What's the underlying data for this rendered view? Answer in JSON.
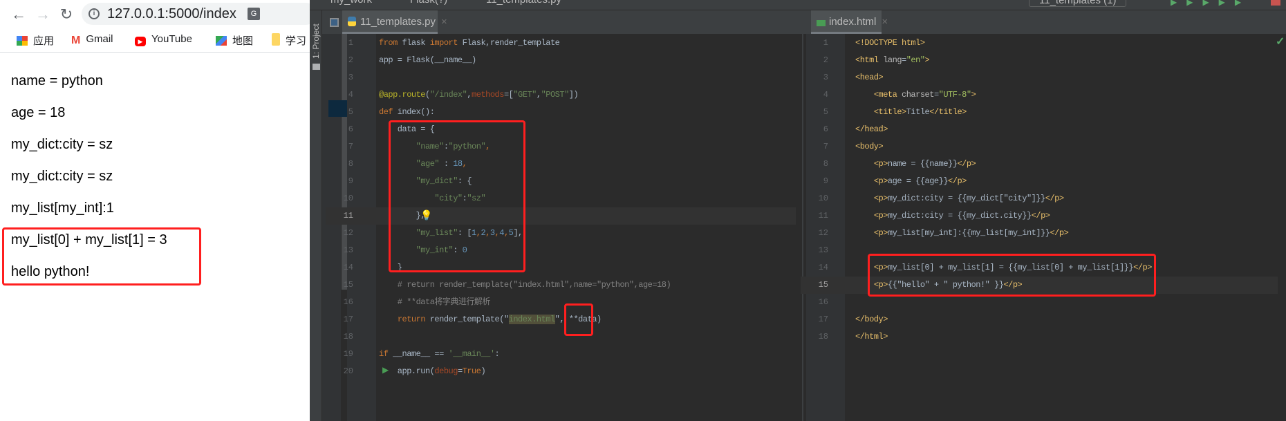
{
  "browser": {
    "url": "127.0.0.1:5000/index",
    "bookmarks": [
      {
        "label": "应用",
        "icon": "apps-grid-icon"
      },
      {
        "label": "Gmail",
        "icon": "gmail-icon"
      },
      {
        "label": "YouTube",
        "icon": "youtube-icon"
      },
      {
        "label": "地图",
        "icon": "maps-icon"
      },
      {
        "label": "学习",
        "icon": "folder-icon"
      }
    ],
    "page_lines": [
      "name = python",
      "age = 18",
      "my_dict:city = sz",
      "my_dict:city = sz",
      "my_list[my_int]:1",
      "my_list[0] + my_list[1] = 3",
      "hello python!"
    ]
  },
  "ide": {
    "breadcrumb": [
      "my_work",
      "Flask(?)",
      "11_templates.py"
    ],
    "run_config": "11_templates (1)",
    "project_label": "1: Project",
    "left_tab": "11_templates.py",
    "right_tab": "index.html",
    "left_code": [
      [
        [
          "from",
          "kw"
        ],
        [
          " flask ",
          ""
        ],
        [
          "import",
          "kw"
        ],
        [
          " Flask,render_template",
          ""
        ]
      ],
      [
        [
          "app = Flask(__name__)",
          ""
        ]
      ],
      [],
      [
        [
          "@app.route",
          "dec"
        ],
        [
          "(",
          ""
        ],
        [
          "\"/index\"",
          "str"
        ],
        [
          ",",
          ""
        ],
        [
          "methods",
          "kwarg"
        ],
        [
          "=[",
          ""
        ],
        [
          "\"GET\"",
          "str"
        ],
        [
          ",",
          ""
        ],
        [
          "\"POST\"",
          "str"
        ],
        [
          "])",
          ""
        ]
      ],
      [
        [
          "def",
          "kw"
        ],
        [
          " index():",
          ""
        ]
      ],
      [
        [
          "    data = {",
          ""
        ]
      ],
      [
        [
          "        ",
          ""
        ],
        [
          "\"name\"",
          "str"
        ],
        [
          ":",
          ""
        ],
        [
          "\"python\"",
          "str"
        ],
        [
          ",",
          "kw"
        ]
      ],
      [
        [
          "        ",
          ""
        ],
        [
          "\"age\"",
          "str"
        ],
        [
          " : ",
          ""
        ],
        [
          "18",
          "num"
        ],
        [
          ",",
          "kw"
        ]
      ],
      [
        [
          "        ",
          ""
        ],
        [
          "\"my_dict\"",
          "str"
        ],
        [
          ": {",
          ""
        ]
      ],
      [
        [
          "            ",
          ""
        ],
        [
          "\"city\"",
          "str"
        ],
        [
          ":",
          ""
        ],
        [
          "\"sz\"",
          "str"
        ]
      ],
      [
        [
          "        },",
          ""
        ]
      ],
      [
        [
          "        ",
          ""
        ],
        [
          "\"my_list\"",
          "str"
        ],
        [
          ": [",
          ""
        ],
        [
          "1",
          "num"
        ],
        [
          ",",
          "kw"
        ],
        [
          "2",
          "num"
        ],
        [
          ",",
          "kw"
        ],
        [
          "3",
          "num"
        ],
        [
          ",",
          "kw"
        ],
        [
          "4",
          "num"
        ],
        [
          ",",
          "kw"
        ],
        [
          "5",
          "num"
        ],
        [
          "],",
          ""
        ]
      ],
      [
        [
          "        ",
          ""
        ],
        [
          "\"my_int\"",
          "str"
        ],
        [
          ": ",
          ""
        ],
        [
          "0",
          "num"
        ]
      ],
      [
        [
          "    }",
          ""
        ]
      ],
      [
        [
          "    # return render_template(\"index.html\",name=\"python\",age=18)",
          "cm"
        ]
      ],
      [
        [
          "    # **data将字典进行解析",
          "cm"
        ]
      ],
      [
        [
          "    ",
          ""
        ],
        [
          "return",
          "kw"
        ],
        [
          " render_template(\"",
          ""
        ],
        [
          "index.html",
          "str hl"
        ],
        [
          "\", **data)",
          ""
        ]
      ],
      [],
      [
        [
          "if",
          "kw"
        ],
        [
          " __name__ == ",
          ""
        ],
        [
          "'__main__'",
          "str"
        ],
        [
          ":",
          ""
        ]
      ],
      [
        [
          "    app.run(",
          ""
        ],
        [
          "debug",
          "kwarg"
        ],
        [
          "=",
          ""
        ],
        [
          "True",
          "kw"
        ],
        [
          ")",
          ""
        ]
      ]
    ],
    "right_code": [
      [
        [
          "<!DOCTYPE html>",
          "tag"
        ]
      ],
      [
        [
          "<html ",
          "tag"
        ],
        [
          "lang",
          "attr"
        ],
        [
          "=",
          ""
        ],
        [
          "\"en\"",
          "val"
        ],
        [
          ">",
          "tag"
        ]
      ],
      [
        [
          "<head>",
          "tag"
        ]
      ],
      [
        [
          "    ",
          ""
        ],
        [
          "<meta ",
          "tag"
        ],
        [
          "charset",
          "attr"
        ],
        [
          "=",
          ""
        ],
        [
          "\"UTF-8\"",
          "val"
        ],
        [
          ">",
          "tag"
        ]
      ],
      [
        [
          "    ",
          ""
        ],
        [
          "<title>",
          "tag"
        ],
        [
          "Title",
          ""
        ],
        [
          "</title>",
          "tag"
        ]
      ],
      [
        [
          "</head>",
          "tag"
        ]
      ],
      [
        [
          "<body>",
          "tag"
        ]
      ],
      [
        [
          "    ",
          ""
        ],
        [
          "<p>",
          "tag"
        ],
        [
          "name = {{name}}",
          ""
        ],
        [
          "</p>",
          "tag"
        ]
      ],
      [
        [
          "    ",
          ""
        ],
        [
          "<p>",
          "tag"
        ],
        [
          "age = {{age}}",
          ""
        ],
        [
          "</p>",
          "tag"
        ]
      ],
      [
        [
          "    ",
          ""
        ],
        [
          "<p>",
          "tag"
        ],
        [
          "my_dict:city = {{my_dict[\"city\"]}}",
          ""
        ],
        [
          "</p>",
          "tag"
        ]
      ],
      [
        [
          "    ",
          ""
        ],
        [
          "<p>",
          "tag"
        ],
        [
          "my_dict:city = {{my_dict.city}}",
          ""
        ],
        [
          "</p>",
          "tag"
        ]
      ],
      [
        [
          "    ",
          ""
        ],
        [
          "<p>",
          "tag"
        ],
        [
          "my_list[my_int]:{{my_list[my_int]}}",
          ""
        ],
        [
          "</p>",
          "tag"
        ]
      ],
      [],
      [
        [
          "    ",
          ""
        ],
        [
          "<p>",
          "tag"
        ],
        [
          "my_list[0] + my_list[1] = {{my_list[0] + my_list[1]}}",
          ""
        ],
        [
          "</p>",
          "tag"
        ]
      ],
      [
        [
          "    ",
          ""
        ],
        [
          "<p>",
          "tag"
        ],
        [
          "{{\"hello\" + \" python!\" }}",
          ""
        ],
        [
          "</p>",
          "tag"
        ]
      ],
      [],
      [
        [
          "</body>",
          "tag"
        ]
      ],
      [
        [
          "</html>",
          "tag"
        ]
      ]
    ]
  },
  "colors": {
    "annotation_red": "#ff1f1f",
    "editor_bg": "#2b2b2b",
    "keyword": "#cc7832",
    "string": "#6a8759"
  }
}
